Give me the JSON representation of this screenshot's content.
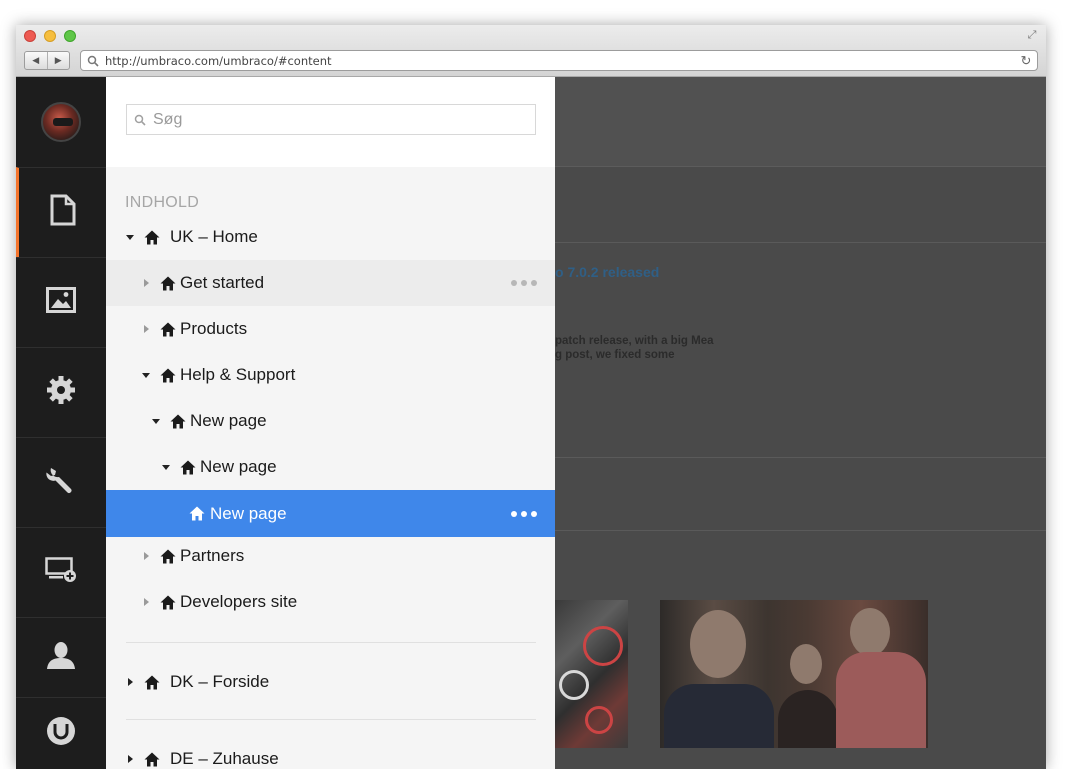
{
  "browser": {
    "url": "http://umbraco.com/umbraco/#content"
  },
  "rail": {
    "items": [
      {
        "name": "rail-avatar"
      },
      {
        "name": "rail-content",
        "icon": "document-icon",
        "active": true
      },
      {
        "name": "rail-media",
        "icon": "image-icon"
      },
      {
        "name": "rail-settings",
        "icon": "gear-icon"
      },
      {
        "name": "rail-developer",
        "icon": "wrench-icon"
      },
      {
        "name": "rail-forms",
        "icon": "screen-plus-icon"
      },
      {
        "name": "rail-members",
        "icon": "user-icon"
      },
      {
        "name": "rail-umbraco",
        "icon": "umbraco-logo-icon"
      }
    ],
    "accent": "#f5742b"
  },
  "tree": {
    "search_placeholder": "Søg",
    "section_title": "INDHOLD",
    "selected_color": "#3f87ea",
    "nodes": [
      {
        "label": "UK – Home",
        "expanded": true
      },
      {
        "label": "Get started",
        "expanded": false,
        "hover": true
      },
      {
        "label": "Products",
        "expanded": false
      },
      {
        "label": "Help & Support",
        "expanded": true
      },
      {
        "label": "New page",
        "expanded": true
      },
      {
        "label": "New page",
        "expanded": true
      },
      {
        "label": "New page",
        "selected": true
      },
      {
        "label": "Partners",
        "expanded": false
      },
      {
        "label": "Developers site",
        "expanded": false
      }
    ],
    "roots": [
      {
        "label": "DK – Forside",
        "expanded": false
      },
      {
        "label": "DE – Zuhause",
        "expanded": false
      }
    ]
  },
  "backdrop": {
    "news_title": "o 7.0.2 released",
    "news_text_1": "patch release, with a big Mea",
    "news_text_2": "g post, we fixed some"
  }
}
